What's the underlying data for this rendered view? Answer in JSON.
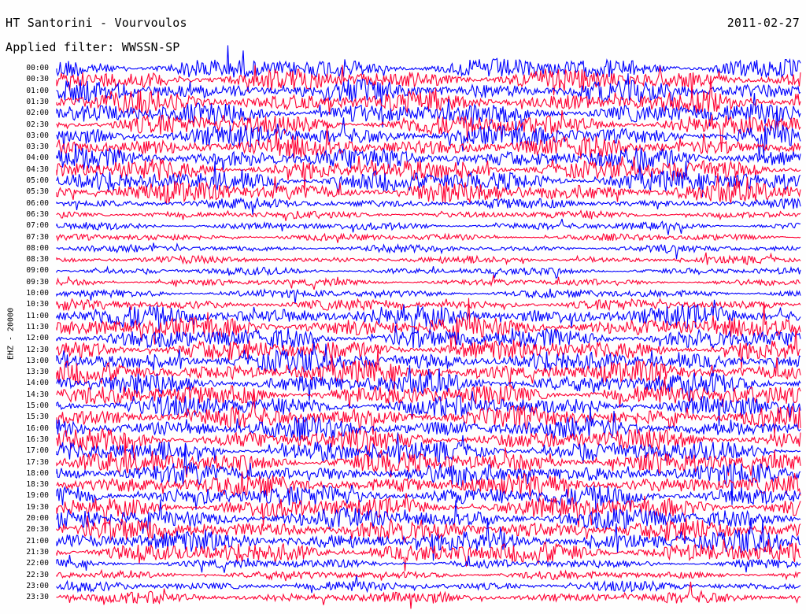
{
  "header": {
    "title": "HT Santorini - Vourvoulos",
    "date": "2011-02-27",
    "filter": "Applied filter: WWSSN-SP"
  },
  "chart_data": {
    "type": "line",
    "title": "HT Santorini - Vourvoulos",
    "date": "2011-02-27",
    "filter": "WWSSN-SP",
    "ylabel": "EHZ - 20000",
    "row_labels": [
      "00:00",
      "00:30",
      "01:00",
      "01:30",
      "02:00",
      "02:30",
      "03:00",
      "03:30",
      "04:00",
      "04:30",
      "05:00",
      "05:30",
      "06:00",
      "06:30",
      "07:00",
      "07:30",
      "08:00",
      "08:30",
      "09:00",
      "09:30",
      "10:00",
      "10:30",
      "11:00",
      "11:30",
      "12:00",
      "12:30",
      "13:00",
      "13:30",
      "14:00",
      "14:30",
      "15:00",
      "15:30",
      "16:00",
      "16:30",
      "17:00",
      "17:30",
      "18:00",
      "18:30",
      "19:00",
      "19:30",
      "20:00",
      "20:30",
      "21:00",
      "21:30",
      "22:00",
      "22:30",
      "23:00",
      "23:30"
    ],
    "series": [
      {
        "color": "#0000ff",
        "rows": "00:00 / 01:00 / ... (full hours)"
      },
      {
        "color": "#ff0033",
        "rows": "00:30 / 01:30 / ... (half hours)"
      }
    ],
    "relative_amplitude": [
      3,
      3,
      3,
      3,
      3,
      3,
      3,
      3,
      3,
      3,
      3,
      3,
      1.4,
      1.1,
      1.1,
      1.0,
      1.0,
      1.0,
      1.0,
      1.0,
      1.2,
      1.5,
      3,
      3,
      3,
      3,
      3,
      3,
      3,
      3,
      3,
      3,
      3,
      3,
      3,
      3,
      3,
      3,
      3,
      3,
      3,
      3,
      3,
      3,
      1.3,
      1.2,
      1.4,
      1.6
    ],
    "colors": {
      "trace_a": "#0000ff",
      "trace_b": "#ff0033",
      "background": "#fefefe"
    }
  }
}
